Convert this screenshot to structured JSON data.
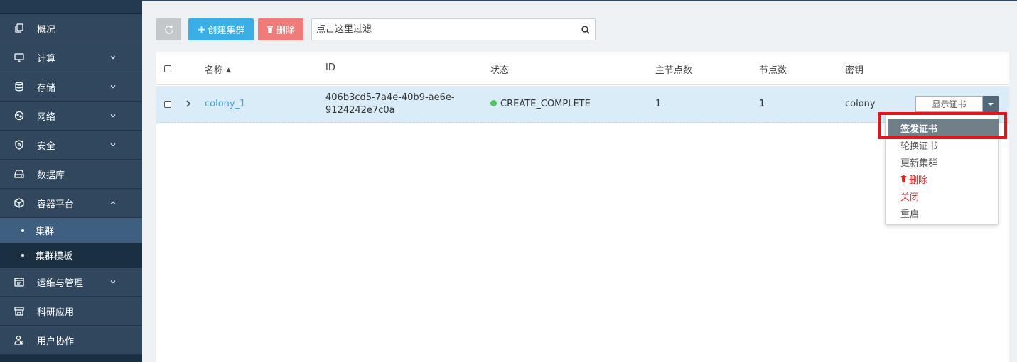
{
  "sidebar": {
    "items": [
      {
        "label": "概况",
        "icon": "copy-icon",
        "expandable": false
      },
      {
        "label": "计算",
        "icon": "monitor-icon",
        "expandable": true
      },
      {
        "label": "存储",
        "icon": "database-icon",
        "expandable": true
      },
      {
        "label": "网络",
        "icon": "network-icon",
        "expandable": true
      },
      {
        "label": "安全",
        "icon": "shield-icon",
        "expandable": true
      },
      {
        "label": "数据库",
        "icon": "drive-icon",
        "expandable": false
      },
      {
        "label": "容器平台",
        "icon": "cube-icon",
        "expandable": true,
        "expanded": true
      }
    ],
    "subitems": [
      {
        "label": "集群",
        "active": true
      },
      {
        "label": "集群模板",
        "active": false
      }
    ],
    "items_after": [
      {
        "label": "运维与管理",
        "icon": "calendar-icon",
        "expandable": true
      },
      {
        "label": "科研应用",
        "icon": "store-icon",
        "expandable": false
      },
      {
        "label": "用户协作",
        "icon": "users-icon",
        "expandable": false
      }
    ]
  },
  "toolbar": {
    "refresh_icon": "refresh-icon",
    "create_label": "创建集群",
    "delete_label": "删除",
    "filter_placeholder": "点击这里过滤"
  },
  "table": {
    "columns": [
      "名称",
      "ID",
      "状态",
      "主节点数",
      "节点数",
      "密钥"
    ],
    "sort_column": "名称",
    "rows": [
      {
        "name": "colony_1",
        "id_line1": "406b3cd5-7a4e-40b9-ae6e-",
        "id_line2": "9124242e7c0a",
        "status": "CREATE_COMPLETE",
        "master_count": "1",
        "node_count": "1",
        "keypair": "colony",
        "action_label": "显示证书"
      }
    ]
  },
  "dropdown": {
    "items": [
      {
        "label": "签发证书",
        "selected": true
      },
      {
        "label": "轮换证书"
      },
      {
        "label": "更新集群"
      },
      {
        "label": "删除",
        "danger": true,
        "icon": "trash-icon"
      },
      {
        "label": "关闭",
        "danger": true
      },
      {
        "label": "重启"
      }
    ]
  },
  "colors": {
    "sidebar_bg": "#30475e",
    "accent_blue": "#3baee6",
    "danger_red": "#ef7b7b",
    "status_green": "#4cc35c",
    "highlight_red": "#e3141c"
  }
}
